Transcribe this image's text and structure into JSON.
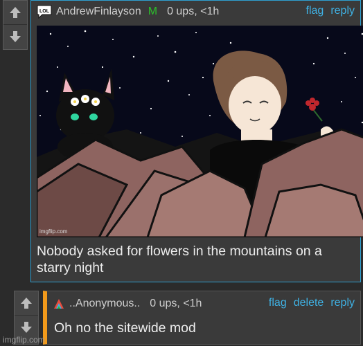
{
  "comment1": {
    "username": "AndrewFinlayson",
    "mod_badge": "M",
    "stats": "0 ups, <1h",
    "links": [
      "flag",
      "reply"
    ],
    "avatar_text": "LOL",
    "image_watermark": "imgflip.com",
    "text": "Nobody asked for flowers in the mountains on a starry night"
  },
  "comment2": {
    "username": "..Anonymous..",
    "stats": "0 ups, <1h",
    "links": [
      "flag",
      "delete",
      "reply"
    ],
    "text": "Oh no the sitewide mod"
  },
  "footer": {
    "watermark": "imgflip.com"
  },
  "colors": {
    "link": "#3fb2e5",
    "mod": "#2cc02c",
    "accent_border": "#f29a1b",
    "frame": "#2f9fd0"
  }
}
